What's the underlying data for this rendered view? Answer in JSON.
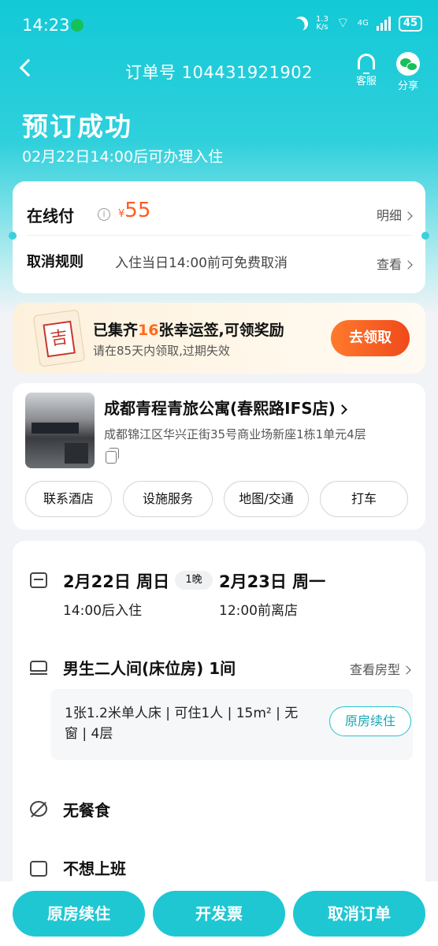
{
  "status_bar": {
    "time": "14:23",
    "net_speed_top": "1.3",
    "net_speed_bottom": "K/s",
    "network": "4G",
    "battery": "45"
  },
  "nav": {
    "order_label": "订单号 104431921902",
    "service_label": "客服",
    "share_label": "分享"
  },
  "hero": {
    "title": "预订成功",
    "subtitle": "02月22日14:00后可办理入住"
  },
  "payment": {
    "label": "在线付",
    "info_icon": "i",
    "currency": "¥",
    "amount": "55",
    "detail_link": "明细",
    "cancel_label": "取消规则",
    "cancel_text": "入住当日14:00前可免费取消",
    "view_link": "查看"
  },
  "lucky": {
    "tag_char": "吉",
    "title_pre": "已集齐",
    "title_num": "16",
    "title_post": "张幸运签,可领奖励",
    "subtitle": "请在85天内领取,过期失效",
    "claim_button": "去领取"
  },
  "hotel": {
    "name": "成都青程青旅公寓(春熙路IFS店)",
    "address": "成都锦江区华兴正街35号商业场新座1栋1单元4层",
    "buttons": [
      "联系酒店",
      "设施服务",
      "地图/交通",
      "打车"
    ]
  },
  "stay": {
    "checkin_date": "2月22日 周日",
    "nights": "1晚",
    "checkout_date": "2月23日 周一",
    "checkin_time": "14:00后入住",
    "checkout_time": "12:00前离店",
    "room_name": "男生二人间(床位房) 1间",
    "view_room_link": "查看房型",
    "room_desc_line1": "1张1.2米单人床 | 可住1人 | 15m² | 无",
    "room_desc_line2": "窗 | 4层",
    "renew_pill": "原房续住",
    "meal": "无餐食",
    "trip_tag": "不想上班"
  },
  "bottom_bar": {
    "renew": "原房续住",
    "invoice": "开发票",
    "cancel": "取消订单"
  },
  "colors": {
    "accent": "#1fc7d3",
    "price": "#ff5a1f",
    "claim": "#f04a1a"
  }
}
